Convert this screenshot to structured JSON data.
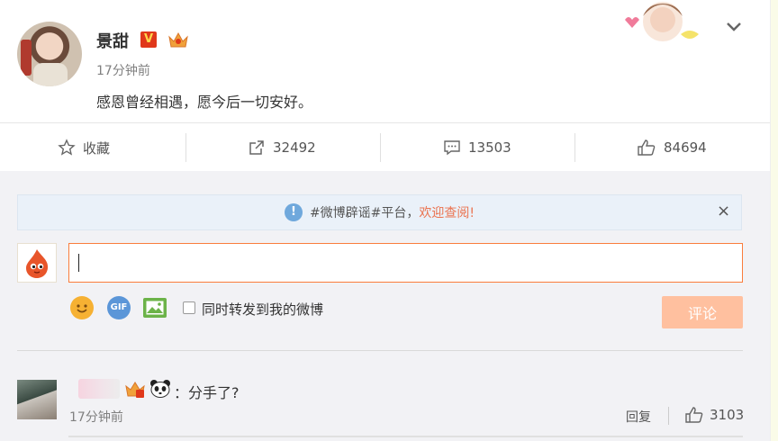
{
  "post": {
    "username": "景甜",
    "verified_badge": "V",
    "timestamp": "17分钟前",
    "text": "感恩曾经相遇，愿今后一切安好。"
  },
  "actions": {
    "favorite_label": "收藏",
    "repost_count": "32492",
    "comment_count": "13503",
    "like_count": "84694"
  },
  "notice": {
    "prefix": "#微博辟谣#平台，",
    "link": "欢迎查阅!",
    "close": "×"
  },
  "composer": {
    "input_value": "",
    "repost_option_label": "同时转发到我的微博",
    "submit_label": "评论",
    "gif_icon_text": "GIF"
  },
  "comments": [
    {
      "text": "：分手了?",
      "timestamp": "17分钟前",
      "reply_label": "回复",
      "like_count": "3103"
    }
  ],
  "colors": {
    "accent": "#fa7d3c",
    "notice_link": "#eb7350",
    "submit_disabled": "#ffc09f",
    "verified": "#e0381a"
  },
  "icons": [
    "star-icon",
    "repost-icon",
    "comment-icon",
    "like-icon",
    "info-icon",
    "close-icon",
    "chevron-down-icon",
    "emoji-icon",
    "gif-icon",
    "image-icon",
    "crown-badge-icon",
    "panda-icon"
  ]
}
